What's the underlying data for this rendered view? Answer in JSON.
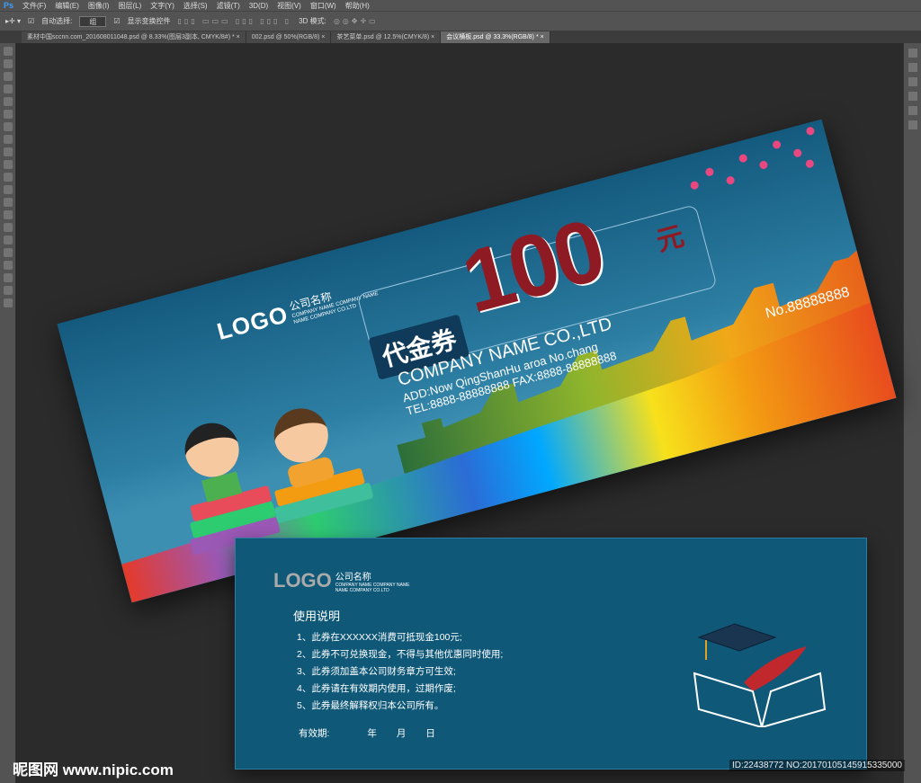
{
  "app": {
    "logo": "Ps",
    "menu": [
      "文件(F)",
      "编辑(E)",
      "图像(I)",
      "图层(L)",
      "文字(Y)",
      "选择(S)",
      "滤镜(T)",
      "3D(D)",
      "视图(V)",
      "窗口(W)",
      "帮助(H)"
    ]
  },
  "options": {
    "auto_select_label": "自动选择:",
    "auto_select_value": "组",
    "show_transform_label": "显示变换控件",
    "mode_3d_label": "3D 模式:"
  },
  "tabs": [
    {
      "label": "素材中国sccnn.com_201608011048.psd @ 8.33%(图层3副本, CMYK/8#) *"
    },
    {
      "label": "002.psd @ 50%(RGB/8)"
    },
    {
      "label": "茶艺菜单.psd @ 12.5%(CMYK/8)"
    },
    {
      "label": "会议横板.psd @ 33.3%(RGB/8) *"
    }
  ],
  "front": {
    "logo": "LOGO",
    "company_cn": "公司名称",
    "company_line1": "COMPANY NAME COMPANY NAME",
    "company_line2": "NAME COMPANY CO.LTD",
    "amount": "100",
    "unit": "元",
    "title": "代金券",
    "company": "COMPANY NAME CO.,LTD",
    "address": "ADD:Now QingShanHu aroa No.chang",
    "tel": "TEL:8888-88888888  FAX:8888-88888888",
    "number": "No.88888888"
  },
  "back": {
    "logo": "LOGO",
    "company_cn": "公司名称",
    "company_line1": "COMPANY NAME COMPANY NAME",
    "company_line2": "NAME COMPANY CO.LTD",
    "heading": "使用说明",
    "rules": [
      "1、此券在XXXXXX消费可抵现金100元;",
      "2、此券不可兑换现金，不得与其他优惠同时使用;",
      "3、此券须加盖本公司财务章方可生效;",
      "4、此券请在有效期内使用，过期作废;",
      "5、此券最终解释权归本公司所有。"
    ],
    "valid_label": "有效期:",
    "year": "年",
    "month": "月",
    "day": "日"
  },
  "watermark": {
    "site": "昵图网 www.nipic.com",
    "id": "ID:22438772 NO:20170105145915335000"
  }
}
